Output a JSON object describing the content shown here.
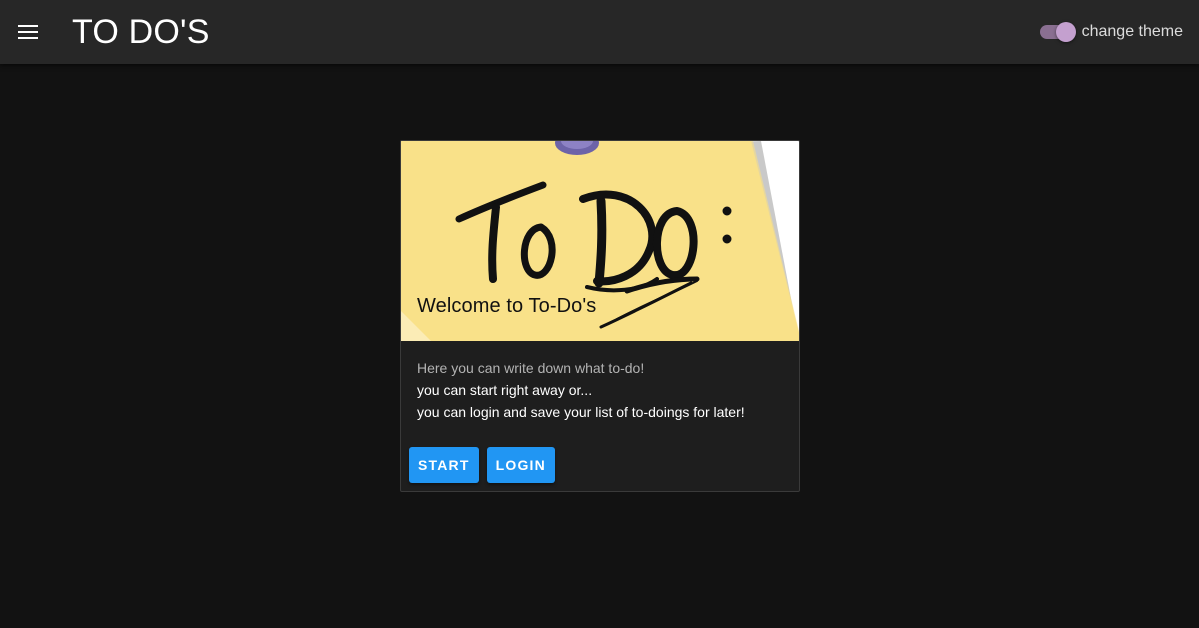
{
  "header": {
    "title": "TO DO'S",
    "menu_icon": "hamburger-menu-icon",
    "theme_toggle": {
      "label": "change theme",
      "on": true,
      "track_color": "#8a6f91",
      "thumb_color": "#c4a0cf"
    }
  },
  "card": {
    "image_icon": "sticky-note-todo-illustration",
    "image_lettering": "To Do:",
    "title": "Welcome to To-Do's",
    "lines": [
      "Here you can write down what to-do!",
      "you can start right away or...",
      "you can login and save your list of to-doings for later!"
    ],
    "buttons": {
      "start": "START",
      "login": "LOGIN"
    },
    "button_color": "#2196f3"
  }
}
